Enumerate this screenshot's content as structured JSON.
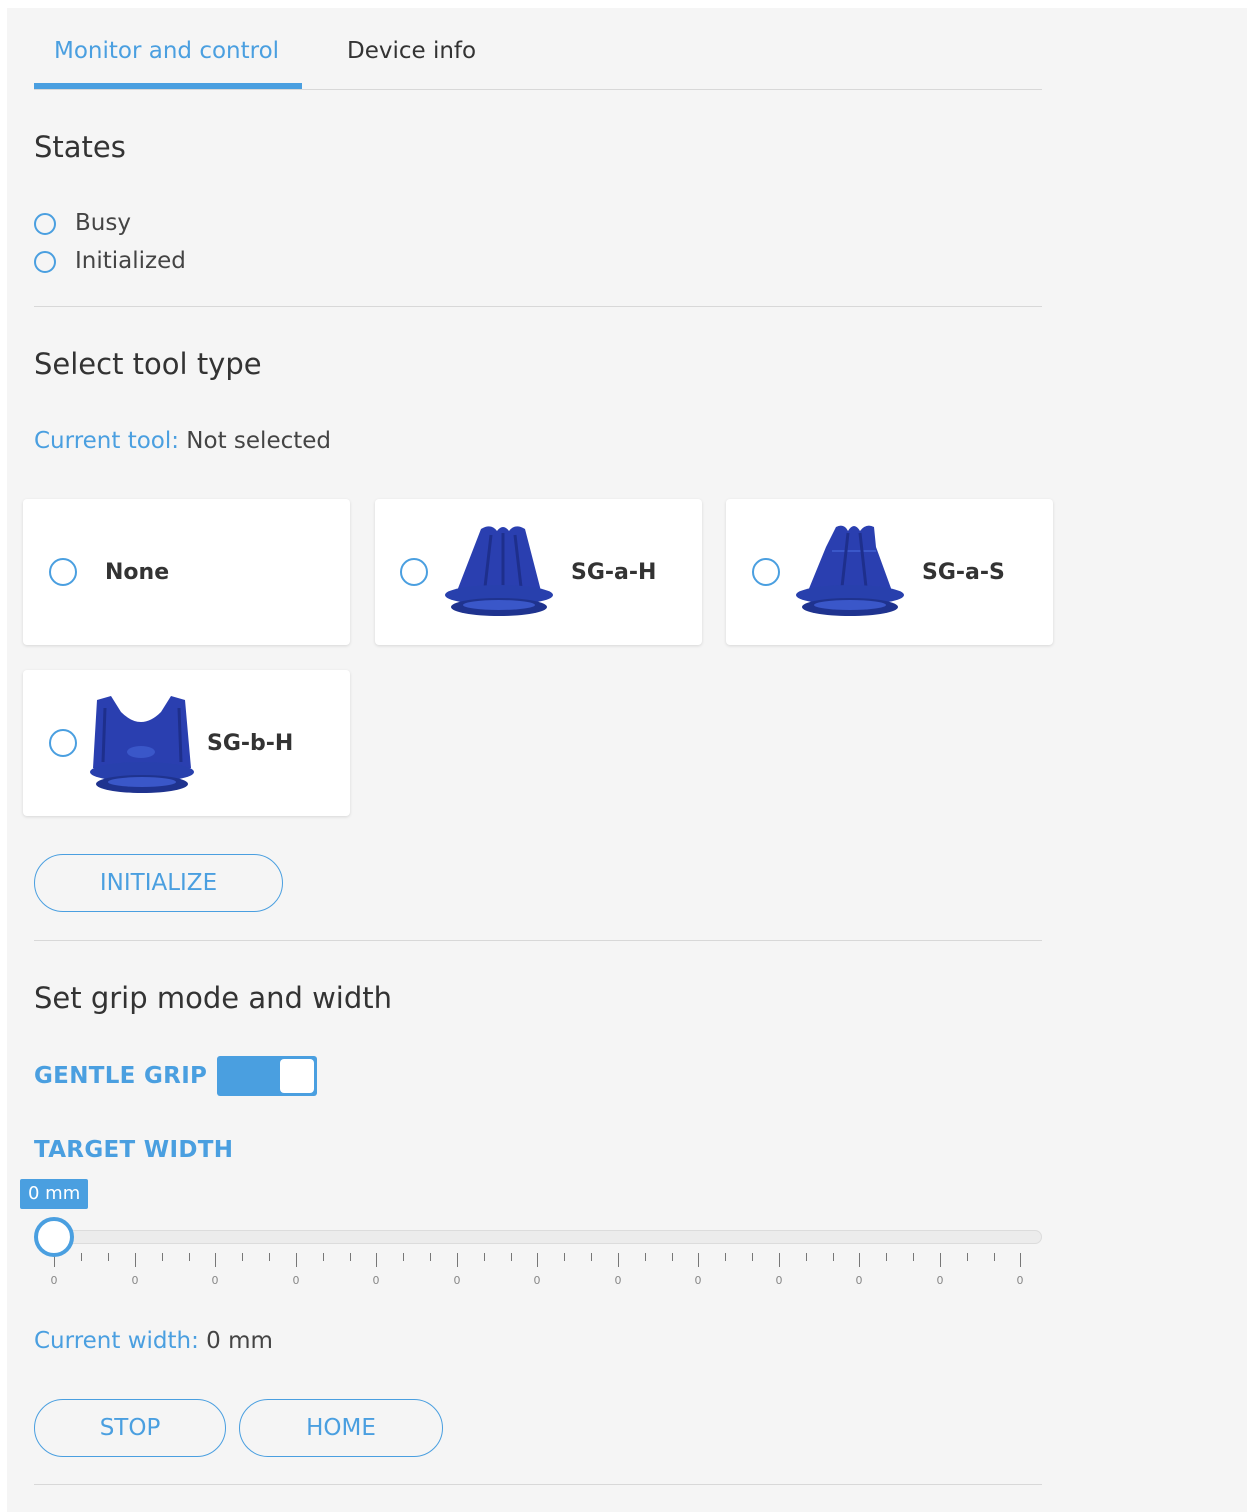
{
  "tabs": [
    {
      "label": "Monitor and control",
      "active": true
    },
    {
      "label": "Device info",
      "active": false
    }
  ],
  "states": {
    "title": "States",
    "items": [
      {
        "label": "Busy"
      },
      {
        "label": "Initialized"
      }
    ]
  },
  "tool": {
    "title": "Select tool type",
    "current_key": "Current tool:",
    "current_value": " Not selected",
    "options": [
      {
        "label": "None"
      },
      {
        "label": "SG-a-H"
      },
      {
        "label": "SG-a-S"
      },
      {
        "label": "SG-b-H"
      }
    ],
    "initialize_label": "INITIALIZE"
  },
  "grip": {
    "title": "Set grip mode and width",
    "gentle_grip_label": "GENTLE GRIP",
    "gentle_grip_on": true,
    "target_width_label": "TARGET WIDTH",
    "slider_value": "0 mm",
    "tick_labels": [
      "0",
      "0",
      "0",
      "0",
      "0",
      "0",
      "0",
      "0",
      "0",
      "0",
      "0",
      "0",
      "0"
    ],
    "current_width_key": "Current width:",
    "current_width_value": " 0 mm",
    "stop_label": "STOP",
    "home_label": "HOME"
  },
  "colors": {
    "accent": "#4a9fe0",
    "tool_blue": "#2a3fb0"
  }
}
